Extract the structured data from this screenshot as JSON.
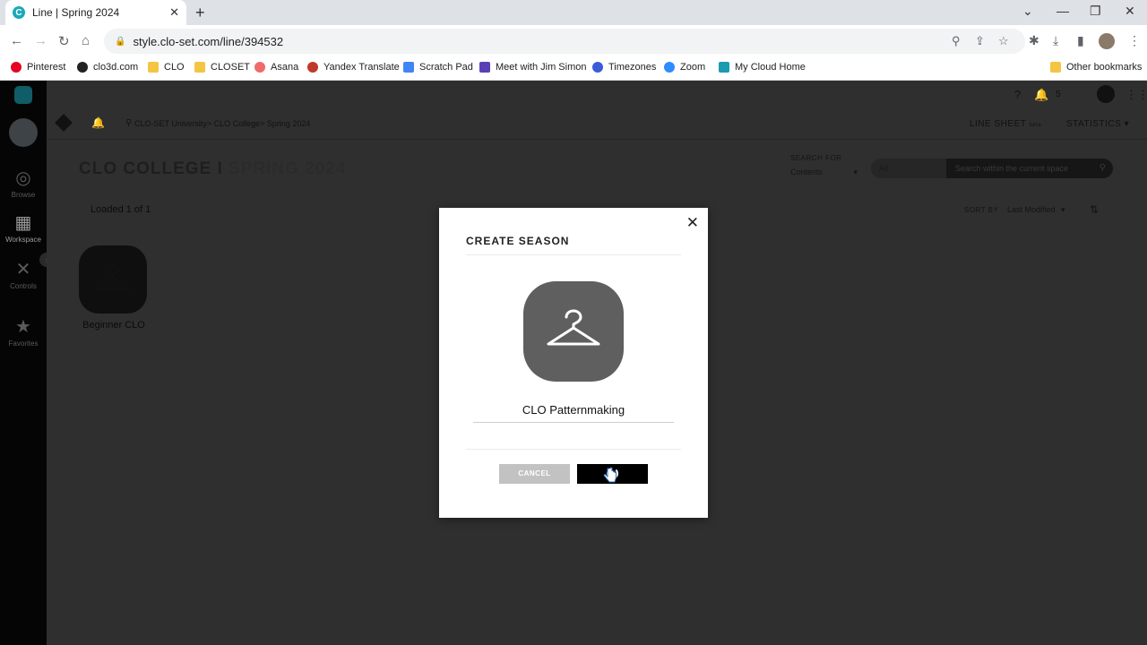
{
  "browser": {
    "tab_title": "Line | Spring 2024",
    "tab_favicon": "C",
    "url": "style.clo-set.com/line/394532",
    "bookmarks": [
      {
        "label": "Pinterest",
        "color": "#e60023"
      },
      {
        "label": "clo3d.com",
        "color": "#222222"
      },
      {
        "label": "CLO",
        "color": "#f4c542"
      },
      {
        "label": "CLOSET",
        "color": "#f4c542"
      },
      {
        "label": "Asana",
        "color": "#f06a6a"
      },
      {
        "label": "Yandex Translate",
        "color": "#c0392b"
      },
      {
        "label": "Scratch Pad",
        "color": "#4285f4"
      },
      {
        "label": "Meet with Jim Simon",
        "color": "#5b3fb5"
      },
      {
        "label": "Timezones",
        "color": "#3b5bdb"
      },
      {
        "label": "Zoom",
        "color": "#2d8cff"
      },
      {
        "label": "My Cloud Home",
        "color": "#1a9bb0"
      }
    ],
    "other_bookmarks": "Other bookmarks"
  },
  "sidebar": {
    "items": [
      {
        "label": "Browse",
        "icon": "compass-icon"
      },
      {
        "label": "Workspace",
        "icon": "grid-icon"
      },
      {
        "label": "Controls",
        "icon": "tools-icon"
      },
      {
        "label": "Favorites",
        "icon": "star-icon"
      }
    ]
  },
  "header": {
    "notification_count": "5",
    "breadcrumbs": "CLO-SET University> CLO College> Spring 2024",
    "line_sheet": "LINE SHEET",
    "line_sheet_badge": "beta",
    "statistics": "STATISTICS"
  },
  "page": {
    "title": "CLO COLLEGE",
    "separator": "I",
    "subtitle": "SPRING 2024",
    "search_for_label": "SEARCH FOR",
    "search_for_value": "Contents",
    "filter_value": "All",
    "search_placeholder": "Search within the current space",
    "loaded_text": "Loaded 1 of 1",
    "sort_by_label": "SORT BY",
    "sort_by_value": "Last Modified",
    "items": [
      {
        "label": "Beginner CLO"
      }
    ]
  },
  "modal": {
    "title": "CREATE SEASON",
    "season_name": "CLO Patternmaking",
    "cancel_label": "CANCEL",
    "create_state": "loading"
  },
  "colors": {
    "accent": "#1aa9b8",
    "backdrop": "#2f2f2f",
    "button_primary": "#000000",
    "button_secondary": "#c2c2c2"
  }
}
